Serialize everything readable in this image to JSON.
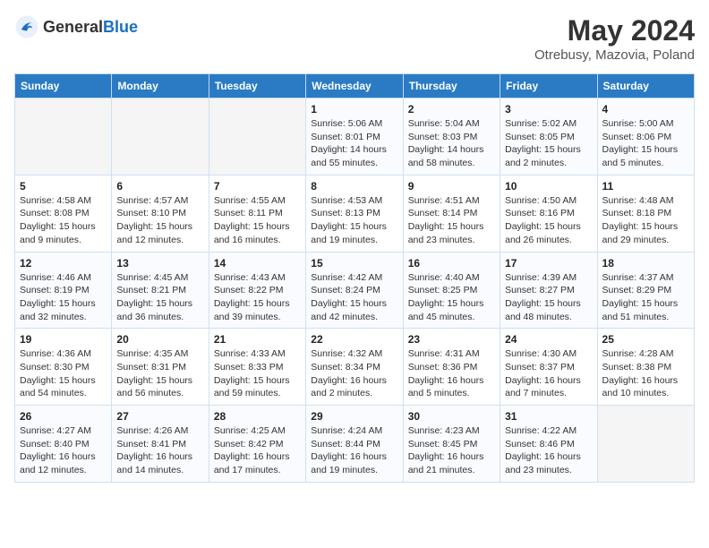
{
  "header": {
    "logo_general": "General",
    "logo_blue": "Blue",
    "title": "May 2024",
    "subtitle": "Otrebusy, Mazovia, Poland"
  },
  "weekdays": [
    "Sunday",
    "Monday",
    "Tuesday",
    "Wednesday",
    "Thursday",
    "Friday",
    "Saturday"
  ],
  "weeks": [
    [
      {
        "day": "",
        "info": ""
      },
      {
        "day": "",
        "info": ""
      },
      {
        "day": "",
        "info": ""
      },
      {
        "day": "1",
        "info": "Sunrise: 5:06 AM\nSunset: 8:01 PM\nDaylight: 14 hours\nand 55 minutes."
      },
      {
        "day": "2",
        "info": "Sunrise: 5:04 AM\nSunset: 8:03 PM\nDaylight: 14 hours\nand 58 minutes."
      },
      {
        "day": "3",
        "info": "Sunrise: 5:02 AM\nSunset: 8:05 PM\nDaylight: 15 hours\nand 2 minutes."
      },
      {
        "day": "4",
        "info": "Sunrise: 5:00 AM\nSunset: 8:06 PM\nDaylight: 15 hours\nand 5 minutes."
      }
    ],
    [
      {
        "day": "5",
        "info": "Sunrise: 4:58 AM\nSunset: 8:08 PM\nDaylight: 15 hours\nand 9 minutes."
      },
      {
        "day": "6",
        "info": "Sunrise: 4:57 AM\nSunset: 8:10 PM\nDaylight: 15 hours\nand 12 minutes."
      },
      {
        "day": "7",
        "info": "Sunrise: 4:55 AM\nSunset: 8:11 PM\nDaylight: 15 hours\nand 16 minutes."
      },
      {
        "day": "8",
        "info": "Sunrise: 4:53 AM\nSunset: 8:13 PM\nDaylight: 15 hours\nand 19 minutes."
      },
      {
        "day": "9",
        "info": "Sunrise: 4:51 AM\nSunset: 8:14 PM\nDaylight: 15 hours\nand 23 minutes."
      },
      {
        "day": "10",
        "info": "Sunrise: 4:50 AM\nSunset: 8:16 PM\nDaylight: 15 hours\nand 26 minutes."
      },
      {
        "day": "11",
        "info": "Sunrise: 4:48 AM\nSunset: 8:18 PM\nDaylight: 15 hours\nand 29 minutes."
      }
    ],
    [
      {
        "day": "12",
        "info": "Sunrise: 4:46 AM\nSunset: 8:19 PM\nDaylight: 15 hours\nand 32 minutes."
      },
      {
        "day": "13",
        "info": "Sunrise: 4:45 AM\nSunset: 8:21 PM\nDaylight: 15 hours\nand 36 minutes."
      },
      {
        "day": "14",
        "info": "Sunrise: 4:43 AM\nSunset: 8:22 PM\nDaylight: 15 hours\nand 39 minutes."
      },
      {
        "day": "15",
        "info": "Sunrise: 4:42 AM\nSunset: 8:24 PM\nDaylight: 15 hours\nand 42 minutes."
      },
      {
        "day": "16",
        "info": "Sunrise: 4:40 AM\nSunset: 8:25 PM\nDaylight: 15 hours\nand 45 minutes."
      },
      {
        "day": "17",
        "info": "Sunrise: 4:39 AM\nSunset: 8:27 PM\nDaylight: 15 hours\nand 48 minutes."
      },
      {
        "day": "18",
        "info": "Sunrise: 4:37 AM\nSunset: 8:29 PM\nDaylight: 15 hours\nand 51 minutes."
      }
    ],
    [
      {
        "day": "19",
        "info": "Sunrise: 4:36 AM\nSunset: 8:30 PM\nDaylight: 15 hours\nand 54 minutes."
      },
      {
        "day": "20",
        "info": "Sunrise: 4:35 AM\nSunset: 8:31 PM\nDaylight: 15 hours\nand 56 minutes."
      },
      {
        "day": "21",
        "info": "Sunrise: 4:33 AM\nSunset: 8:33 PM\nDaylight: 15 hours\nand 59 minutes."
      },
      {
        "day": "22",
        "info": "Sunrise: 4:32 AM\nSunset: 8:34 PM\nDaylight: 16 hours\nand 2 minutes."
      },
      {
        "day": "23",
        "info": "Sunrise: 4:31 AM\nSunset: 8:36 PM\nDaylight: 16 hours\nand 5 minutes."
      },
      {
        "day": "24",
        "info": "Sunrise: 4:30 AM\nSunset: 8:37 PM\nDaylight: 16 hours\nand 7 minutes."
      },
      {
        "day": "25",
        "info": "Sunrise: 4:28 AM\nSunset: 8:38 PM\nDaylight: 16 hours\nand 10 minutes."
      }
    ],
    [
      {
        "day": "26",
        "info": "Sunrise: 4:27 AM\nSunset: 8:40 PM\nDaylight: 16 hours\nand 12 minutes."
      },
      {
        "day": "27",
        "info": "Sunrise: 4:26 AM\nSunset: 8:41 PM\nDaylight: 16 hours\nand 14 minutes."
      },
      {
        "day": "28",
        "info": "Sunrise: 4:25 AM\nSunset: 8:42 PM\nDaylight: 16 hours\nand 17 minutes."
      },
      {
        "day": "29",
        "info": "Sunrise: 4:24 AM\nSunset: 8:44 PM\nDaylight: 16 hours\nand 19 minutes."
      },
      {
        "day": "30",
        "info": "Sunrise: 4:23 AM\nSunset: 8:45 PM\nDaylight: 16 hours\nand 21 minutes."
      },
      {
        "day": "31",
        "info": "Sunrise: 4:22 AM\nSunset: 8:46 PM\nDaylight: 16 hours\nand 23 minutes."
      },
      {
        "day": "",
        "info": ""
      }
    ]
  ]
}
